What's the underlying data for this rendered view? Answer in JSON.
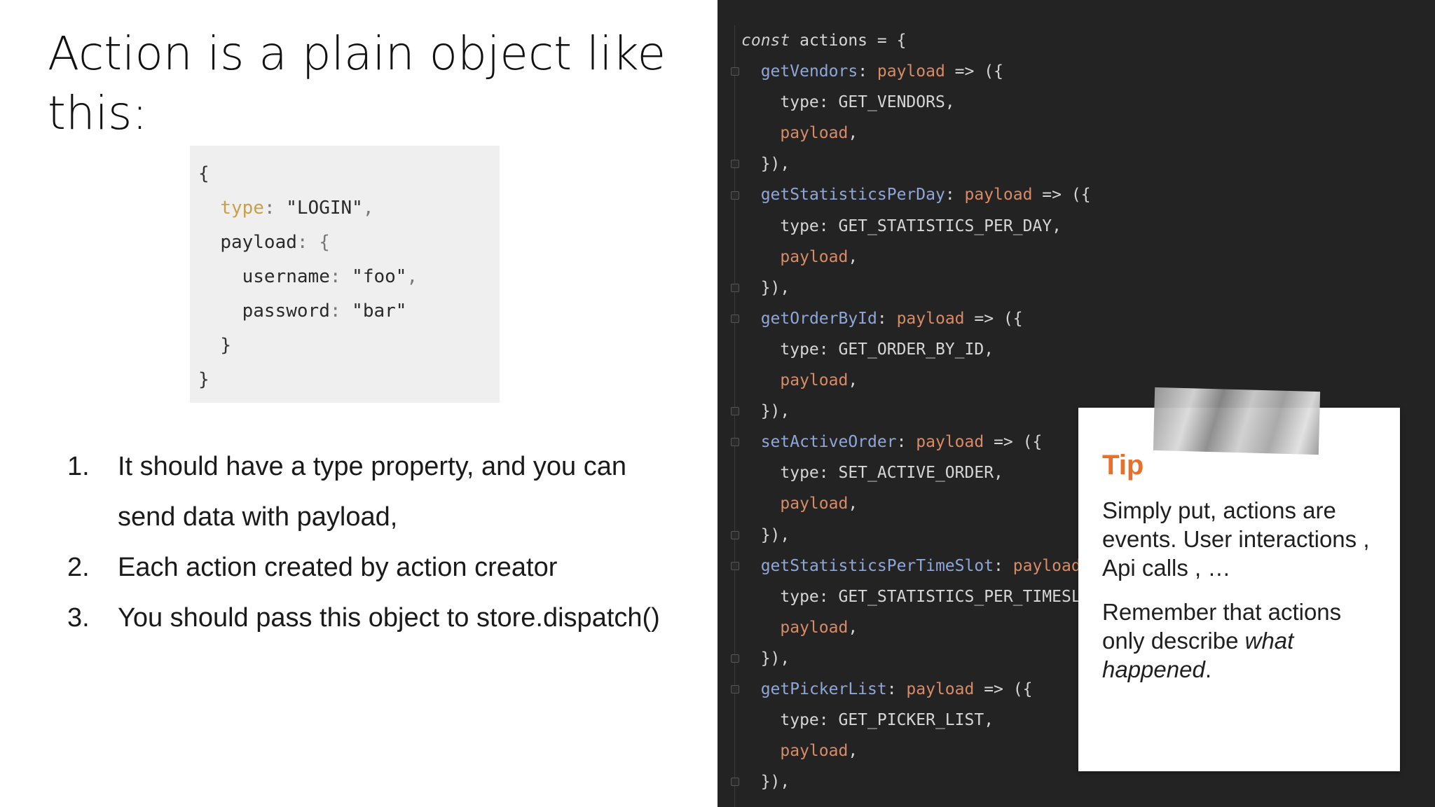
{
  "slide": {
    "title": "Action is a plain object like this:"
  },
  "example_code": {
    "open_brace": "{",
    "type_key": "type",
    "type_value": "\"LOGIN\"",
    "payload_key": "payload",
    "username_key": "username",
    "username_value": "\"foo\"",
    "password_key": "password",
    "password_value": "\"bar\"",
    "inner_close": "}",
    "close_brace": "}"
  },
  "points": [
    {
      "number": "1.",
      "text": "It should have a type property, and you can send data with payload,"
    },
    {
      "number": "2.",
      "text": "Each action created by action creator"
    },
    {
      "number": "3.",
      "text": "You should pass this object to store.dispatch()"
    }
  ],
  "editor": {
    "decl_keyword": "const",
    "decl_name": "actions",
    "param": "payload",
    "actions": [
      {
        "fn": "getVendors",
        "type": "GET_VENDORS"
      },
      {
        "fn": "getStatisticsPerDay",
        "type": "GET_STATISTICS_PER_DAY"
      },
      {
        "fn": "getOrderById",
        "type": "GET_ORDER_BY_ID"
      },
      {
        "fn": "setActiveOrder",
        "type": "SET_ACTIVE_ORDER"
      },
      {
        "fn": "getStatisticsPerTimeSlot",
        "type": "GET_STATISTICS_PER_TIMESLOT"
      },
      {
        "fn": "getPickerList",
        "type": "GET_PICKER_LIST"
      }
    ]
  },
  "tip": {
    "title": "Tip",
    "line1": "Simply put, actions are events. User interactions , Api calls , …",
    "line2_start": "Remember that actions only describe ",
    "line2_em": "what happened",
    "line2_end": "."
  },
  "colors": {
    "editor_bg": "#232323",
    "tip_title": "#e8702a",
    "code_key": "#c9a04a",
    "editor_fn": "#8fa7d8",
    "editor_param": "#d98b66"
  }
}
